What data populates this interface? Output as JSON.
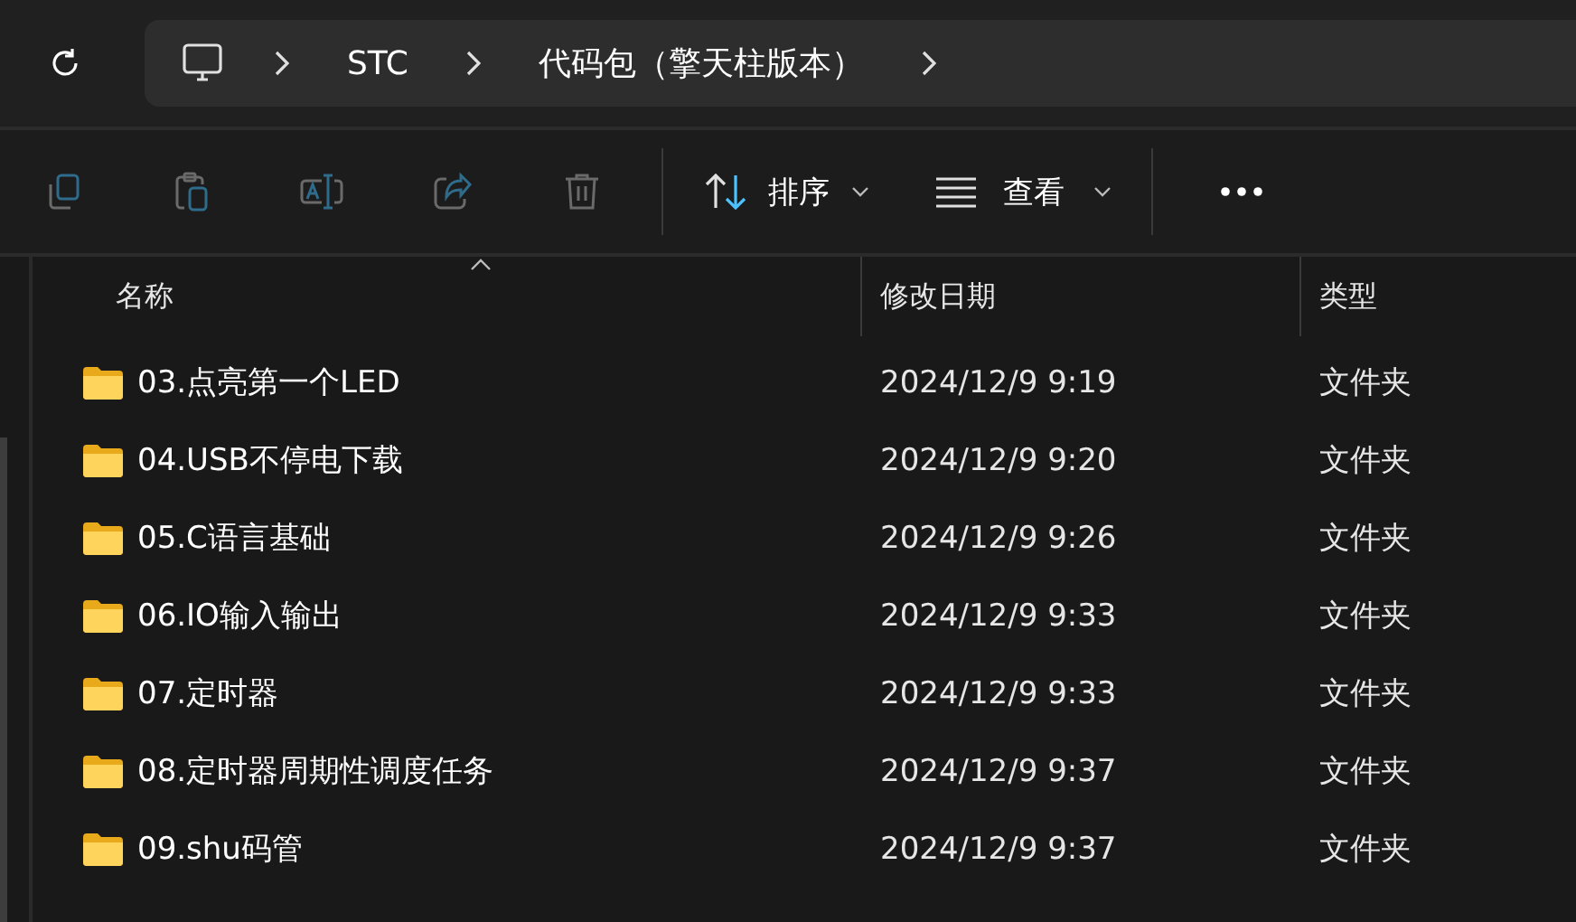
{
  "breadcrumb": {
    "items": [
      "STC",
      "代码包（擎天柱版本）"
    ]
  },
  "toolbar": {
    "actions": [
      {
        "kind": "copy",
        "disabled": true
      },
      {
        "kind": "paste",
        "disabled": true
      },
      {
        "kind": "rename",
        "disabled": true
      },
      {
        "kind": "share",
        "disabled": true
      },
      {
        "kind": "delete",
        "disabled": true
      }
    ],
    "menus": [
      {
        "kind": "sort",
        "label": "排序"
      },
      {
        "kind": "view",
        "label": "查看"
      }
    ]
  },
  "table": {
    "columns": [
      "名称",
      "修改日期",
      "类型"
    ],
    "rows": [
      {
        "name": "03.点亮第一个LED",
        "modified": "2024/12/9 9:19",
        "type": "文件夹"
      },
      {
        "name": "04.USB不停电下载",
        "modified": "2024/12/9 9:20",
        "type": "文件夹"
      },
      {
        "name": "05.C语言基础",
        "modified": "2024/12/9 9:26",
        "type": "文件夹"
      },
      {
        "name": "06.IO输入输出",
        "modified": "2024/12/9 9:33",
        "type": "文件夹"
      },
      {
        "name": "07.定时器",
        "modified": "2024/12/9 9:33",
        "type": "文件夹"
      },
      {
        "name": "08.定时器周期性调度任务",
        "modified": "2024/12/9 9:37",
        "type": "文件夹"
      },
      {
        "name": "09.shu码管",
        "modified": "2024/12/9 9:37",
        "type": "文件夹"
      }
    ]
  }
}
